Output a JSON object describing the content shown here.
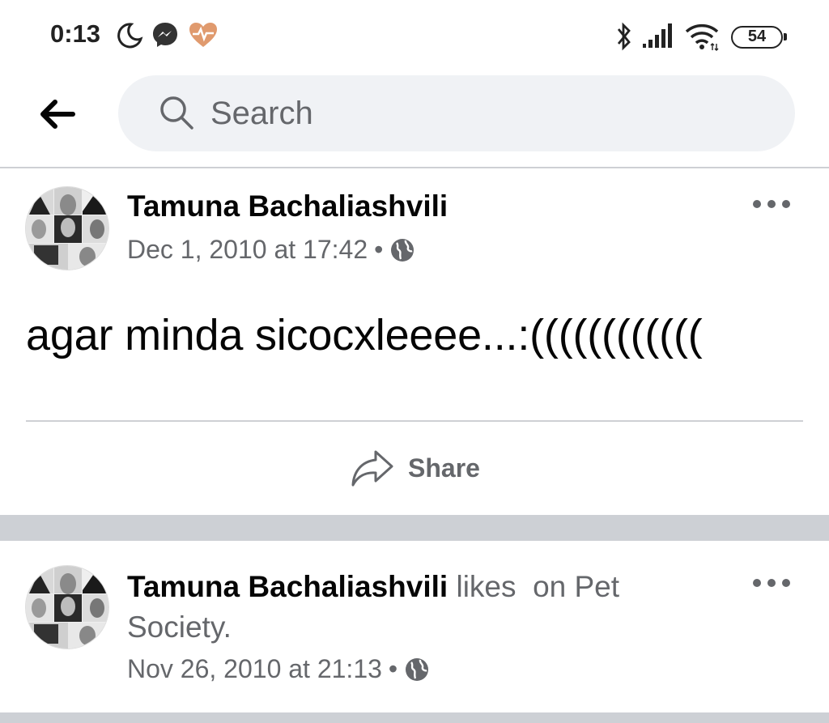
{
  "status_bar": {
    "time": "0:13",
    "battery": "54",
    "icons": [
      "moon-icon",
      "messenger-icon",
      "heart-pulse-icon",
      "bluetooth-icon",
      "signal-icon",
      "wifi-icon",
      "battery-icon"
    ]
  },
  "search": {
    "placeholder": "Search"
  },
  "posts": [
    {
      "author": "Tamuna Bachaliashvili",
      "timestamp": "Dec 1, 2010 at 17:42",
      "separator": "•",
      "privacy_icon": "globe-icon",
      "text": "agar minda sicocxleeee...:((((((((((((",
      "share_label": "Share"
    },
    {
      "author": "Tamuna Bachaliashvili",
      "action": "likes",
      "object": "on Pet Society.",
      "timestamp": "Nov 26, 2010 at 21:13",
      "separator": "•",
      "privacy_icon": "globe-icon"
    }
  ],
  "colors": {
    "primary_text": "#050505",
    "secondary_text": "#65676b",
    "search_bg": "#f0f2f5",
    "separator": "#cdd0d5"
  }
}
